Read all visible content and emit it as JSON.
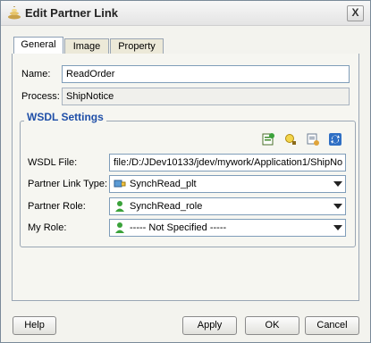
{
  "window": {
    "title": "Edit Partner Link",
    "close_label": "X"
  },
  "tabs": [
    {
      "label": "General",
      "active": true
    },
    {
      "label": "Image",
      "active": false
    },
    {
      "label": "Property",
      "active": false
    }
  ],
  "general": {
    "name_label": "Name:",
    "name_value": "ReadOrder",
    "process_label": "Process:",
    "process_value": "ShipNotice"
  },
  "wsdl": {
    "group_title": "WSDL Settings",
    "toolbar_icons": [
      "service-explorer-icon",
      "create-wsdl-icon",
      "define-adapter-icon",
      "refresh-icon"
    ],
    "file_label": "WSDL File:",
    "file_value": "file:/D:/JDev10133/jdev/mywork/Application1/ShipNo",
    "partner_link_type_label": "Partner Link Type:",
    "partner_link_type_value": "SynchRead_plt",
    "partner_role_label": "Partner Role:",
    "partner_role_value": "SynchRead_role",
    "my_role_label": "My Role:",
    "my_role_value": "----- Not Specified -----"
  },
  "buttons": {
    "help": "Help",
    "apply": "Apply",
    "ok": "OK",
    "cancel": "Cancel"
  },
  "colors": {
    "group_title": "#1f4fa8",
    "panel_bg": "#f6f6f1",
    "border": "#9aa6b4"
  }
}
